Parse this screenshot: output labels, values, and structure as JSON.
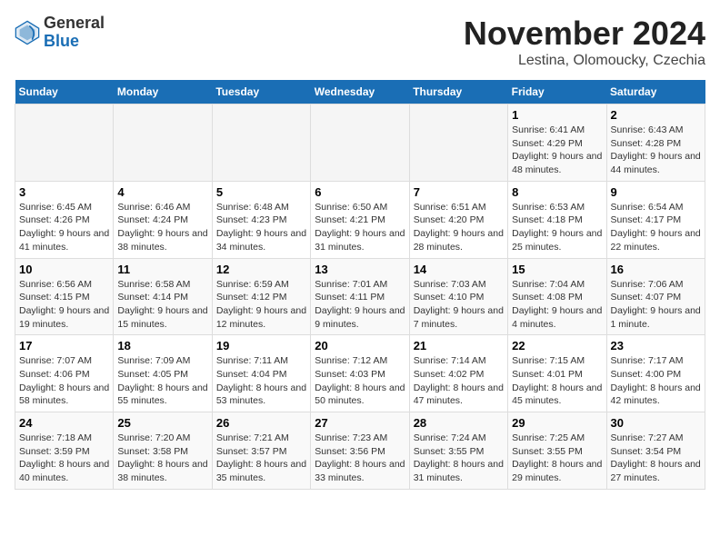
{
  "header": {
    "logo_general": "General",
    "logo_blue": "Blue",
    "month_year": "November 2024",
    "location": "Lestina, Olomoucky, Czechia"
  },
  "days_of_week": [
    "Sunday",
    "Monday",
    "Tuesday",
    "Wednesday",
    "Thursday",
    "Friday",
    "Saturday"
  ],
  "weeks": [
    [
      {
        "day": "",
        "info": ""
      },
      {
        "day": "",
        "info": ""
      },
      {
        "day": "",
        "info": ""
      },
      {
        "day": "",
        "info": ""
      },
      {
        "day": "",
        "info": ""
      },
      {
        "day": "1",
        "info": "Sunrise: 6:41 AM\nSunset: 4:29 PM\nDaylight: 9 hours and 48 minutes."
      },
      {
        "day": "2",
        "info": "Sunrise: 6:43 AM\nSunset: 4:28 PM\nDaylight: 9 hours and 44 minutes."
      }
    ],
    [
      {
        "day": "3",
        "info": "Sunrise: 6:45 AM\nSunset: 4:26 PM\nDaylight: 9 hours and 41 minutes."
      },
      {
        "day": "4",
        "info": "Sunrise: 6:46 AM\nSunset: 4:24 PM\nDaylight: 9 hours and 38 minutes."
      },
      {
        "day": "5",
        "info": "Sunrise: 6:48 AM\nSunset: 4:23 PM\nDaylight: 9 hours and 34 minutes."
      },
      {
        "day": "6",
        "info": "Sunrise: 6:50 AM\nSunset: 4:21 PM\nDaylight: 9 hours and 31 minutes."
      },
      {
        "day": "7",
        "info": "Sunrise: 6:51 AM\nSunset: 4:20 PM\nDaylight: 9 hours and 28 minutes."
      },
      {
        "day": "8",
        "info": "Sunrise: 6:53 AM\nSunset: 4:18 PM\nDaylight: 9 hours and 25 minutes."
      },
      {
        "day": "9",
        "info": "Sunrise: 6:54 AM\nSunset: 4:17 PM\nDaylight: 9 hours and 22 minutes."
      }
    ],
    [
      {
        "day": "10",
        "info": "Sunrise: 6:56 AM\nSunset: 4:15 PM\nDaylight: 9 hours and 19 minutes."
      },
      {
        "day": "11",
        "info": "Sunrise: 6:58 AM\nSunset: 4:14 PM\nDaylight: 9 hours and 15 minutes."
      },
      {
        "day": "12",
        "info": "Sunrise: 6:59 AM\nSunset: 4:12 PM\nDaylight: 9 hours and 12 minutes."
      },
      {
        "day": "13",
        "info": "Sunrise: 7:01 AM\nSunset: 4:11 PM\nDaylight: 9 hours and 9 minutes."
      },
      {
        "day": "14",
        "info": "Sunrise: 7:03 AM\nSunset: 4:10 PM\nDaylight: 9 hours and 7 minutes."
      },
      {
        "day": "15",
        "info": "Sunrise: 7:04 AM\nSunset: 4:08 PM\nDaylight: 9 hours and 4 minutes."
      },
      {
        "day": "16",
        "info": "Sunrise: 7:06 AM\nSunset: 4:07 PM\nDaylight: 9 hours and 1 minute."
      }
    ],
    [
      {
        "day": "17",
        "info": "Sunrise: 7:07 AM\nSunset: 4:06 PM\nDaylight: 8 hours and 58 minutes."
      },
      {
        "day": "18",
        "info": "Sunrise: 7:09 AM\nSunset: 4:05 PM\nDaylight: 8 hours and 55 minutes."
      },
      {
        "day": "19",
        "info": "Sunrise: 7:11 AM\nSunset: 4:04 PM\nDaylight: 8 hours and 53 minutes."
      },
      {
        "day": "20",
        "info": "Sunrise: 7:12 AM\nSunset: 4:03 PM\nDaylight: 8 hours and 50 minutes."
      },
      {
        "day": "21",
        "info": "Sunrise: 7:14 AM\nSunset: 4:02 PM\nDaylight: 8 hours and 47 minutes."
      },
      {
        "day": "22",
        "info": "Sunrise: 7:15 AM\nSunset: 4:01 PM\nDaylight: 8 hours and 45 minutes."
      },
      {
        "day": "23",
        "info": "Sunrise: 7:17 AM\nSunset: 4:00 PM\nDaylight: 8 hours and 42 minutes."
      }
    ],
    [
      {
        "day": "24",
        "info": "Sunrise: 7:18 AM\nSunset: 3:59 PM\nDaylight: 8 hours and 40 minutes."
      },
      {
        "day": "25",
        "info": "Sunrise: 7:20 AM\nSunset: 3:58 PM\nDaylight: 8 hours and 38 minutes."
      },
      {
        "day": "26",
        "info": "Sunrise: 7:21 AM\nSunset: 3:57 PM\nDaylight: 8 hours and 35 minutes."
      },
      {
        "day": "27",
        "info": "Sunrise: 7:23 AM\nSunset: 3:56 PM\nDaylight: 8 hours and 33 minutes."
      },
      {
        "day": "28",
        "info": "Sunrise: 7:24 AM\nSunset: 3:55 PM\nDaylight: 8 hours and 31 minutes."
      },
      {
        "day": "29",
        "info": "Sunrise: 7:25 AM\nSunset: 3:55 PM\nDaylight: 8 hours and 29 minutes."
      },
      {
        "day": "30",
        "info": "Sunrise: 7:27 AM\nSunset: 3:54 PM\nDaylight: 8 hours and 27 minutes."
      }
    ]
  ]
}
